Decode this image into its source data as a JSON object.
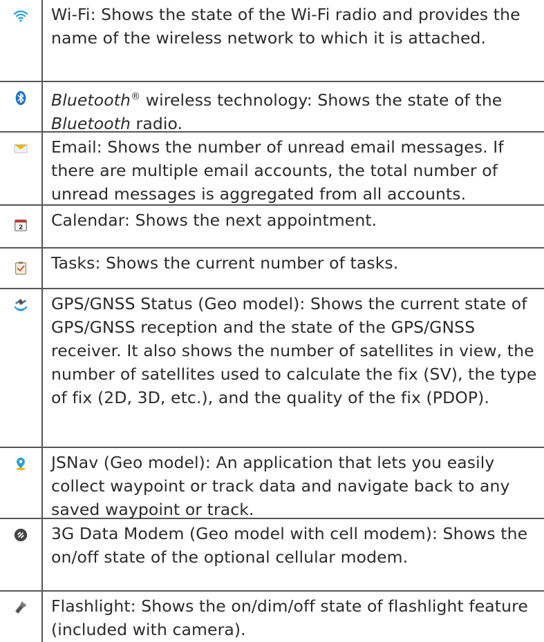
{
  "rows": [
    {
      "icon": "wifi-icon",
      "segments": [
        {
          "text": "Wi-Fi:  Shows the state of the Wi-Fi radio and provides the name of the wireless network to which it is attached.",
          "style": "normal"
        }
      ]
    },
    {
      "icon": "bluetooth-icon",
      "segments": [
        {
          "text": "Bluetooth",
          "style": "italic"
        },
        {
          "text": "®",
          "style": "sup"
        },
        {
          "text": " wireless technology:  Shows the state of the ",
          "style": "normal"
        },
        {
          "text": "Bluetooth",
          "style": "italic"
        },
        {
          "text": " radio.",
          "style": "normal"
        }
      ]
    },
    {
      "icon": "email-icon",
      "segments": [
        {
          "text": "Email:  Shows the number of unread email messages. If there are multiple email accounts, the total number of unread messages is aggregated from all accounts.",
          "style": "normal"
        }
      ]
    },
    {
      "icon": "calendar-icon",
      "segments": [
        {
          "text": "Calendar:  Shows the next appointment.",
          "style": "normal"
        }
      ]
    },
    {
      "icon": "tasks-icon",
      "segments": [
        {
          "text": "Tasks:  Shows the current number of tasks.",
          "style": "normal"
        }
      ]
    },
    {
      "icon": "gps-satellite-icon",
      "segments": [
        {
          "text": "GPS/GNSS Status (Geo model):  Shows the current state of GPS/GNSS reception and the state of the GPS/GNSS receiver. It also shows the number of satellites in view, the number of satellites used to calculate the fix (SV), the type of fix (2D, 3D, etc.), and the quality of the fix (PDOP).",
          "style": "normal"
        }
      ]
    },
    {
      "icon": "jsnav-pin-icon",
      "segments": [
        {
          "text": "JSNav (Geo model):  An application that lets you easily collect waypoint or track data and navigate back to any saved waypoint or track.",
          "style": "normal"
        }
      ]
    },
    {
      "icon": "modem-icon",
      "segments": [
        {
          "text": "3G Data Modem (Geo model with cell modem): Shows the on/off state of the optional cellular modem.",
          "style": "normal"
        }
      ]
    },
    {
      "icon": "flashlight-icon",
      "segments": [
        {
          "text": "Flashlight: Shows the on/dim/off state of flashlight feature (included with camera).",
          "style": "normal"
        }
      ]
    }
  ],
  "colors": {
    "border": "#555555",
    "text": "#2b2b2b",
    "wifi": "#2a9fd8",
    "bluetooth": "#1f6fc5",
    "email": "#f4b400",
    "jsnav": "#2a9fd8"
  }
}
